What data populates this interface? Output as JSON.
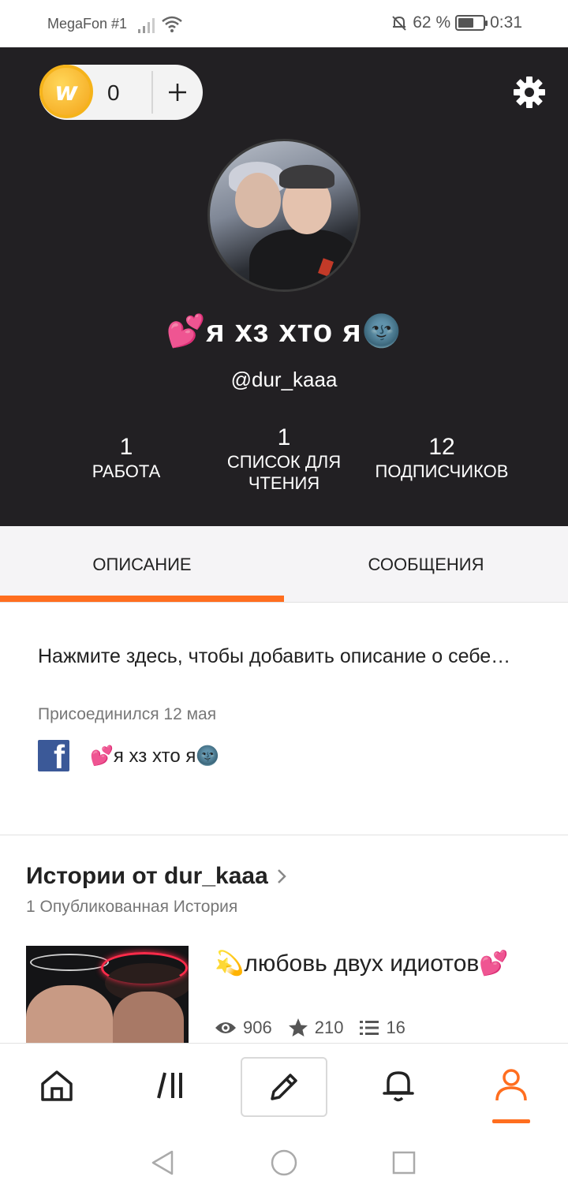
{
  "status_bar": {
    "carrier": "MegaFon #1",
    "battery_percent": "62 %",
    "battery_level": 0.62,
    "time": "0:31"
  },
  "header": {
    "coin_count": "0",
    "display_name": "💕я хз хто я🌚",
    "username": "@dur_kaaa",
    "stats": [
      {
        "value": "1",
        "label": "РАБОТА"
      },
      {
        "value": "1",
        "label": "СПИСОК ДЛЯ ЧТЕНИЯ"
      },
      {
        "value": "12",
        "label": "ПОДПИСЧИКОВ"
      }
    ]
  },
  "tabs": [
    {
      "label": "ОПИСАНИЕ",
      "active": true
    },
    {
      "label": "СООБЩЕНИЯ",
      "active": false
    }
  ],
  "about": {
    "placeholder": "Нажмите здесь, чтобы добавить описание о себе…",
    "joined": "Присоединился 12 мая",
    "facebook_name": "💕я хз хто я🌚"
  },
  "stories": {
    "title": "Истории от dur_kaaa",
    "subtitle": "1 Опубликованная История",
    "items": [
      {
        "title": "💫любовь двух идиотов💕",
        "reads": "906",
        "votes": "210",
        "parts": "16"
      }
    ]
  },
  "icons": {
    "coin": "wattpad-coin-icon",
    "add": "plus-icon",
    "settings": "gear-icon",
    "home": "home-icon",
    "library": "library-icon",
    "write": "pencil-icon",
    "notifications": "bell-icon",
    "profile": "profile-icon"
  },
  "colors": {
    "accent": "#ff6e1f",
    "header_bg": "#222023",
    "facebook": "#3b5998"
  }
}
